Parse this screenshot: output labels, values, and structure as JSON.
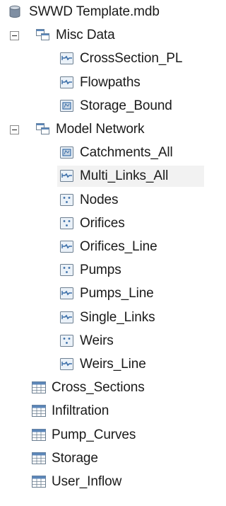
{
  "tree": {
    "root": {
      "label": "SWWD Template.mdb",
      "icon": "database-icon"
    },
    "groups": [
      {
        "label": "Misc Data",
        "icon": "feature-dataset-icon",
        "expanded": true,
        "items": [
          {
            "label": "CrossSection_PL",
            "icon": "line-feature-class-icon"
          },
          {
            "label": "Flowpaths",
            "icon": "line-feature-class-icon"
          },
          {
            "label": "Storage_Bound",
            "icon": "polygon-feature-class-icon"
          }
        ]
      },
      {
        "label": "Model Network",
        "icon": "feature-dataset-icon",
        "expanded": true,
        "items": [
          {
            "label": "Catchments_All",
            "icon": "polygon-feature-class-icon"
          },
          {
            "label": "Multi_Links_All",
            "icon": "line-feature-class-icon",
            "selected": true
          },
          {
            "label": "Nodes",
            "icon": "point-feature-class-icon"
          },
          {
            "label": "Orifices",
            "icon": "point-feature-class-icon"
          },
          {
            "label": "Orifices_Line",
            "icon": "line-feature-class-icon"
          },
          {
            "label": "Pumps",
            "icon": "point-feature-class-icon"
          },
          {
            "label": "Pumps_Line",
            "icon": "line-feature-class-icon"
          },
          {
            "label": "Single_Links",
            "icon": "line-feature-class-icon"
          },
          {
            "label": "Weirs",
            "icon": "point-feature-class-icon"
          },
          {
            "label": "Weirs_Line",
            "icon": "line-feature-class-icon"
          }
        ]
      }
    ],
    "tables": [
      {
        "label": "Cross_Sections",
        "icon": "table-icon"
      },
      {
        "label": "Infiltration",
        "icon": "table-icon"
      },
      {
        "label": "Pump_Curves",
        "icon": "table-icon"
      },
      {
        "label": "Storage",
        "icon": "table-icon"
      },
      {
        "label": "User_Inflow",
        "icon": "table-icon"
      }
    ]
  },
  "colors": {
    "icon_blue": "#3a6ea8",
    "icon_border": "#6d7f91",
    "icon_fill": "#eaf1f8",
    "table_header": "#5b86b8",
    "db_body": "#7f8fa3",
    "selected_row": "#f2f2f2",
    "text": "#1a1a1a"
  }
}
